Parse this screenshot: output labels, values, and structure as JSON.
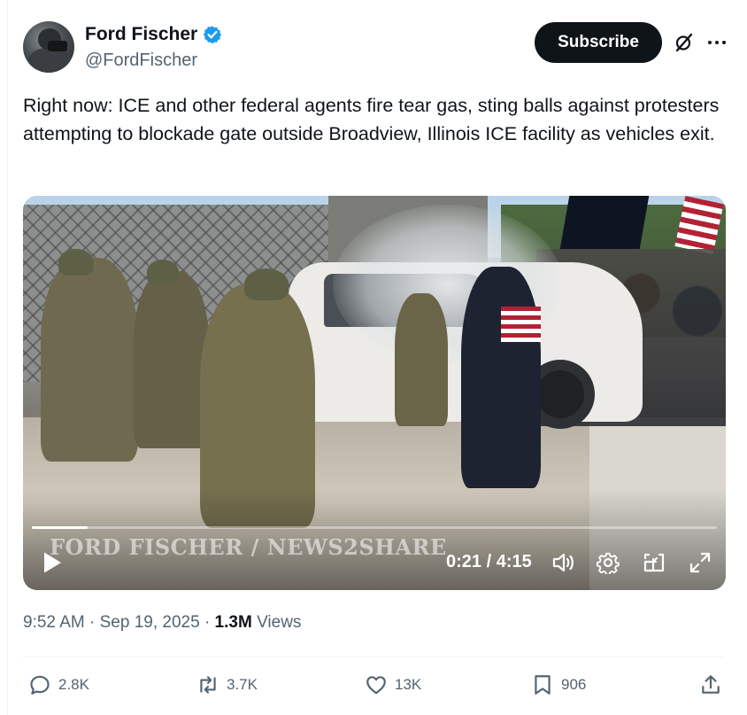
{
  "author": {
    "display_name": "Ford Fischer",
    "handle": "@FordFischer",
    "verified": true
  },
  "header": {
    "subscribe_label": "Subscribe"
  },
  "tweet": {
    "text": "Right now: ICE and other federal agents fire tear gas, sting balls against protesters attempting to blockade gate outside Broadview, Illinois ICE facility as vehicles exit."
  },
  "video": {
    "watermark": "FORD FISCHER / NEWS2SHARE",
    "time": "0:21 / 4:15",
    "progress": 0.082
  },
  "meta": {
    "time": "9:52 AM",
    "date": "Sep 19, 2025",
    "views_count": "1.3M",
    "views_label": "Views",
    "separator": "·"
  },
  "actions": {
    "replies": "2.8K",
    "reposts": "3.7K",
    "likes": "13K",
    "bookmarks": "906"
  },
  "colors": {
    "accent": "#1d9bf0",
    "text_primary": "#0f1419",
    "text_secondary": "#536471"
  }
}
